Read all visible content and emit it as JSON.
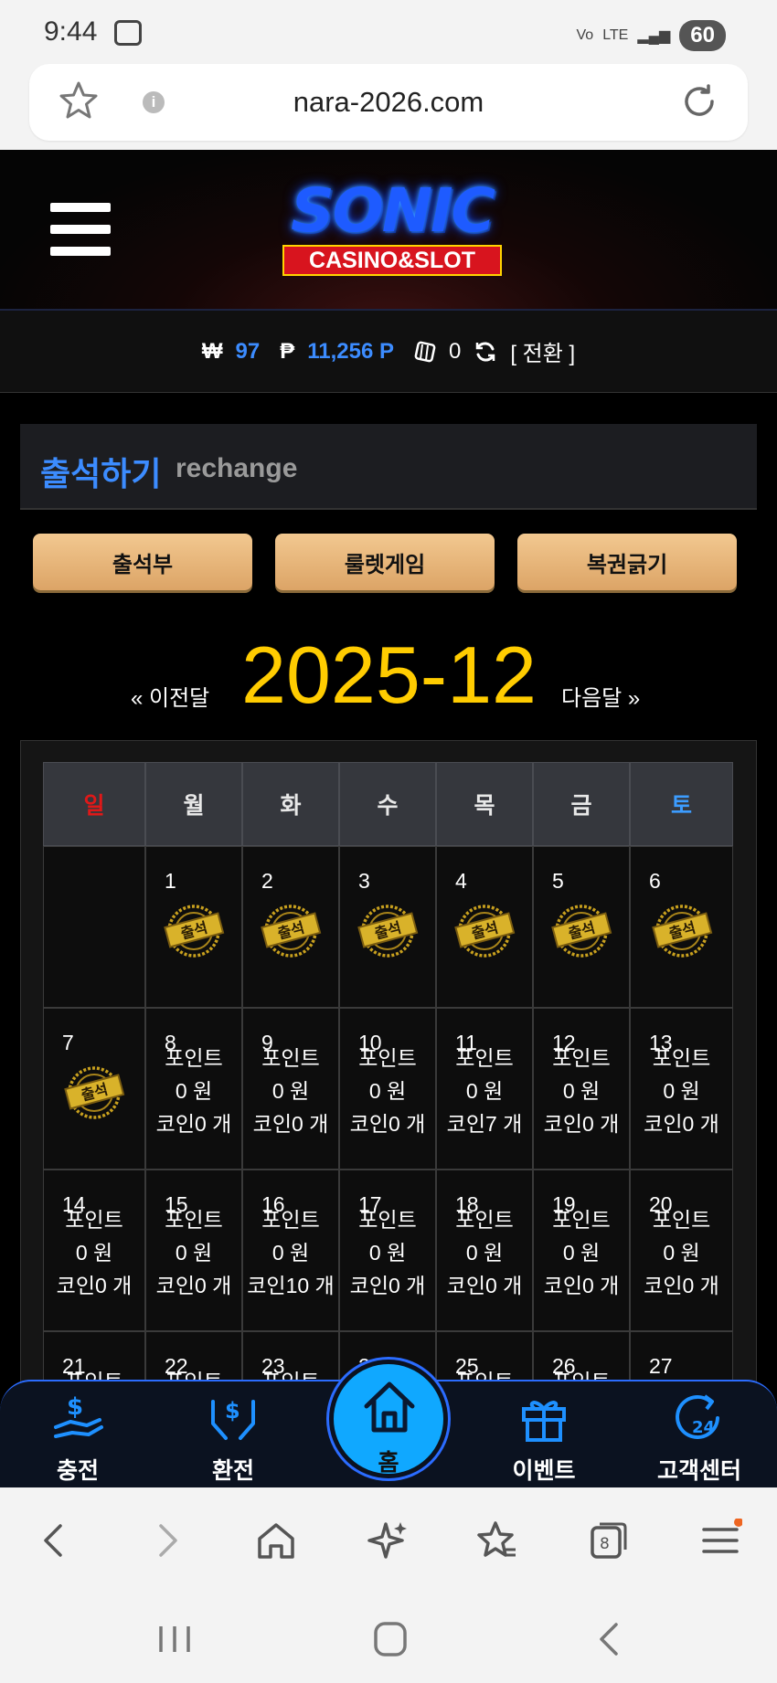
{
  "status": {
    "time": "9:44",
    "network": "LTE",
    "battery": "60"
  },
  "browser": {
    "url": "nara-2026.com"
  },
  "header": {
    "logo_main": "SONIC",
    "logo_sub": "CASINO&SLOT"
  },
  "balance": {
    "won_icon": "₩",
    "won_value": "97",
    "point_icon": "₱",
    "point_value": "11,256 P",
    "coin_value": "0",
    "convert_label": "[ 전환 ]"
  },
  "attendance": {
    "title": "출석하기",
    "subtitle": "rechange"
  },
  "tabs": [
    "출석부",
    "룰렛게임",
    "복권긁기"
  ],
  "calendar": {
    "prev_label": "« 이전달",
    "month": "2025-12",
    "next_label": "다음달 »",
    "weekdays": [
      "일",
      "월",
      "화",
      "수",
      "목",
      "금",
      "토"
    ],
    "cells": [
      {
        "day": "",
        "stamp": false
      },
      {
        "day": "1",
        "stamp": true
      },
      {
        "day": "2",
        "stamp": true
      },
      {
        "day": "3",
        "stamp": true
      },
      {
        "day": "4",
        "stamp": true
      },
      {
        "day": "5",
        "stamp": true
      },
      {
        "day": "6",
        "stamp": true
      },
      {
        "day": "7",
        "stamp": true
      },
      {
        "day": "8",
        "point_label": "포인트",
        "point": "0 원",
        "coin": "코인0 개"
      },
      {
        "day": "9",
        "point_label": "포인트",
        "point": "0 원",
        "coin": "코인0 개"
      },
      {
        "day": "10",
        "point_label": "포인트",
        "point": "0 원",
        "coin": "코인0 개"
      },
      {
        "day": "11",
        "point_label": "포인트",
        "point": "0 원",
        "coin": "코인7 개"
      },
      {
        "day": "12",
        "point_label": "포인트",
        "point": "0 원",
        "coin": "코인0 개"
      },
      {
        "day": "13",
        "point_label": "포인트",
        "point": "0 원",
        "coin": "코인0 개"
      },
      {
        "day": "14",
        "point_label": "포인트",
        "point": "0 원",
        "coin": "코인0 개"
      },
      {
        "day": "15",
        "point_label": "포인트",
        "point": "0 원",
        "coin": "코인0 개"
      },
      {
        "day": "16",
        "point_label": "포인트",
        "point": "0 원",
        "coin": "코인10 개"
      },
      {
        "day": "17",
        "point_label": "포인트",
        "point": "0 원",
        "coin": "코인0 개"
      },
      {
        "day": "18",
        "point_label": "포인트",
        "point": "0 원",
        "coin": "코인0 개"
      },
      {
        "day": "19",
        "point_label": "포인트",
        "point": "0 원",
        "coin": "코인0 개"
      },
      {
        "day": "20",
        "point_label": "포인트",
        "point": "0 원",
        "coin": "코인0 개"
      },
      {
        "day": "21",
        "point_label": "포인트"
      },
      {
        "day": "22",
        "point_label": "포인트"
      },
      {
        "day": "23",
        "point_label": "포인트"
      },
      {
        "day": "24",
        "point_label": ""
      },
      {
        "day": "25",
        "point_label": "포인트"
      },
      {
        "day": "26",
        "point_label": "포인트"
      },
      {
        "day": "27",
        "point_label": ""
      }
    ]
  },
  "bottom_nav": {
    "charge": "충전",
    "exchange": "환전",
    "home": "홈",
    "event": "이벤트",
    "support": "고객센터"
  },
  "stamp_text": "출석",
  "colors": {
    "accent": "#3c8cff",
    "month": "#ffcc00",
    "sunday": "#e01818",
    "saturday": "#3c9cff",
    "tab_gold": "#e9b87a"
  }
}
